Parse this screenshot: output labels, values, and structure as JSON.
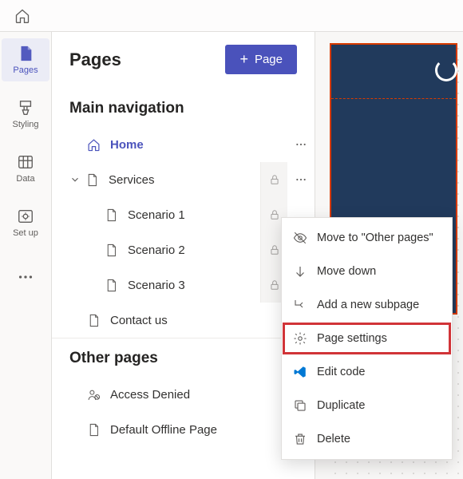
{
  "topbar": {
    "home_label": "Home"
  },
  "rail": {
    "items": [
      {
        "label": "Pages"
      },
      {
        "label": "Styling"
      },
      {
        "label": "Data"
      },
      {
        "label": "Set up"
      }
    ]
  },
  "panel": {
    "title": "Pages",
    "new_button": "Page"
  },
  "sections": {
    "main_nav_title": "Main navigation",
    "other_pages_title": "Other pages"
  },
  "tree": {
    "home": "Home",
    "services": "Services",
    "scenario1": "Scenario 1",
    "scenario2": "Scenario 2",
    "scenario3": "Scenario 3",
    "contact": "Contact us",
    "access_denied": "Access Denied",
    "default_offline": "Default Offline Page"
  },
  "context_menu": {
    "move_other": "Move to \"Other pages\"",
    "move_down": "Move down",
    "add_subpage": "Add a new subpage",
    "page_settings": "Page settings",
    "edit_code": "Edit code",
    "duplicate": "Duplicate",
    "delete": "Delete"
  }
}
